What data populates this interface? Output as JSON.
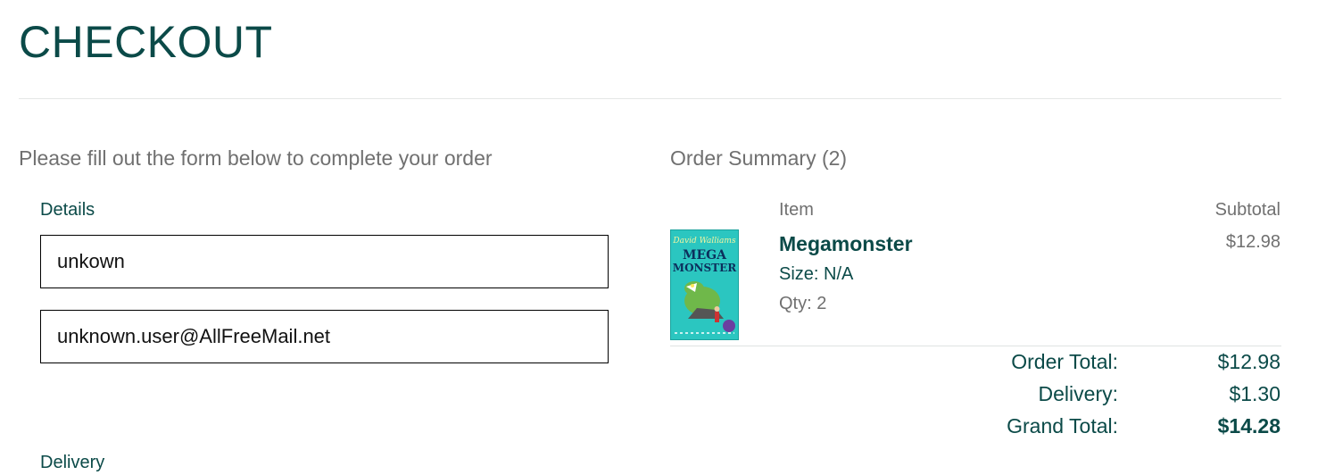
{
  "page": {
    "title": "CHECKOUT",
    "form_intro": "Please fill out the form below to complete your order"
  },
  "details": {
    "label": "Details",
    "name_value": "unkown",
    "email_value": "unknown.user@AllFreeMail.net"
  },
  "delivery": {
    "label": "Delivery"
  },
  "summary": {
    "title": "Order Summary (2)",
    "col_item": "Item",
    "col_subtotal": "Subtotal",
    "items": [
      {
        "name": "Megamonster",
        "size": "Size: N/A",
        "qty": "Qty: 2",
        "subtotal": "$12.98",
        "cover_author": "David Walliams",
        "cover_title": "MEGA MONSTER"
      }
    ],
    "order_total_label": "Order Total:",
    "order_total_value": "$12.98",
    "delivery_label": "Delivery:",
    "delivery_value": "$1.30",
    "grand_total_label": "Grand Total:",
    "grand_total_value": "$14.28"
  },
  "colors": {
    "brand": "#0b4a48",
    "muted": "#707070",
    "cover": "#2bc6c0"
  }
}
